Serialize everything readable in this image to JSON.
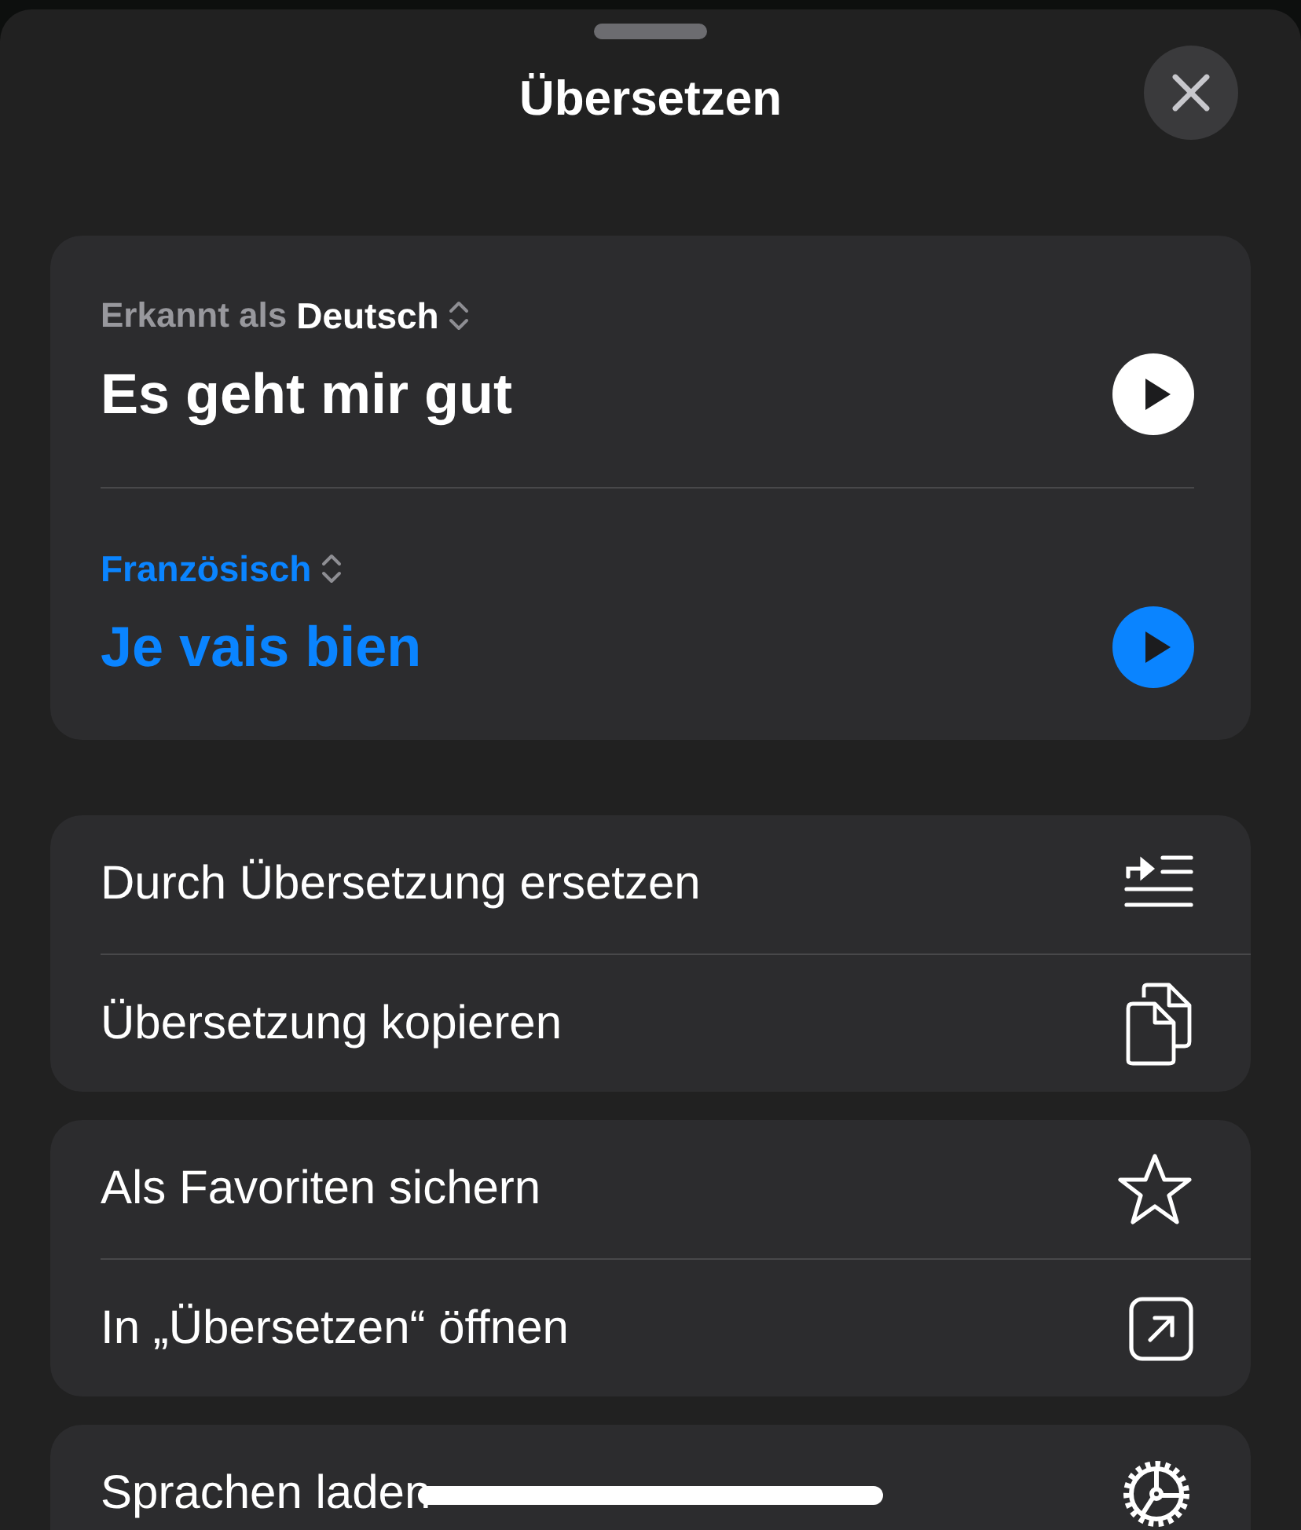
{
  "sheet": {
    "title": "Übersetzen"
  },
  "source": {
    "label": "Erkannt als",
    "language": "Deutsch",
    "text": "Es geht mir gut"
  },
  "target": {
    "language": "Französisch",
    "text": "Je vais bien"
  },
  "action_groups": [
    {
      "actions": [
        {
          "label": "Durch Übersetzung ersetzen"
        },
        {
          "label": "Übersetzung kopieren"
        }
      ]
    },
    {
      "actions": [
        {
          "label": "Als Favoriten sichern"
        },
        {
          "label": "In „Übersetzen“ öffnen"
        }
      ]
    },
    {
      "actions": [
        {
          "label": "Sprachen laden"
        }
      ]
    }
  ]
}
